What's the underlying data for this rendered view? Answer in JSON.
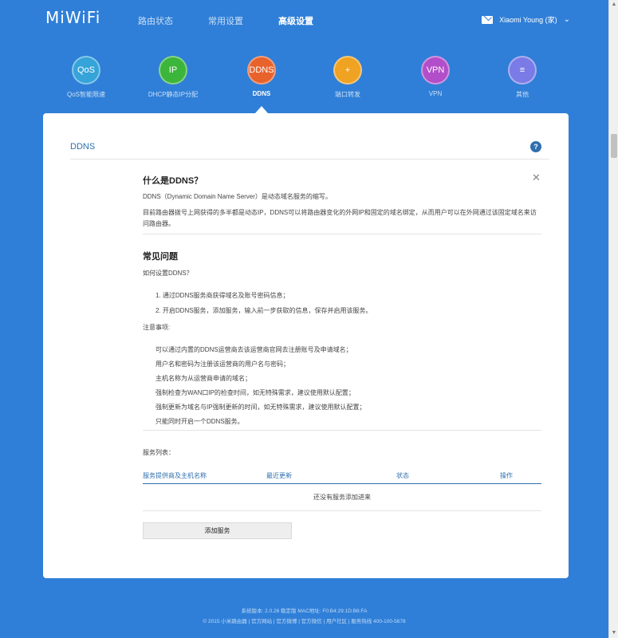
{
  "header": {
    "logo": "MiWiFi",
    "nav": [
      "路由状态",
      "常用设置",
      "高级设置"
    ],
    "user": "Xiaomi Young (家)"
  },
  "features": [
    {
      "icon_text": "QoS",
      "label": "QoS智能限速",
      "color": "#36a3d9"
    },
    {
      "icon_text": "IP",
      "label": "DHCP静态IP分配",
      "color": "#3bb53a"
    },
    {
      "icon_text": "DDNS",
      "label": "DDNS",
      "color": "#e8622c"
    },
    {
      "icon_text": "+",
      "label": "端口转发",
      "color": "#f0a223"
    },
    {
      "icon_text": "VPN",
      "label": "VPN",
      "color": "#b24ec9"
    },
    {
      "icon_text": "≡",
      "label": "其他",
      "color": "#7a7be6"
    }
  ],
  "card": {
    "title": "DDNS",
    "help_icon": "?",
    "what_title": "什么是DDNS？",
    "what_p1": "DDNS（Dynamic Domain Name Server）是动态域名服务的缩写。",
    "what_p2": "目前路由器拨号上网获得的多半都是动态IP，DDNS可以将路由器变化的外网IP和固定的域名绑定，从而用户可以在外网通过该固定域名来访问路由器。",
    "faq_title": "常见问题",
    "faq_q": "如何设置DDNS？",
    "faq_steps": [
      "1. 通过DDNS服务商获得域名及账号密码信息；",
      "2. 开启DDNS服务，添加服务，输入前一步获取的信息，保存并启用该服务。"
    ],
    "notes_title": "注意事项:",
    "notes": [
      "可以通过内置的DDNS运营商去该运营商官网去注册账号及申请域名；",
      "用户名和密码为注册该运营商的用户名与密码；",
      "主机名称为从运营商申请的域名；",
      "强制检查为WAN口IP的检查时间，如无特殊需求，建议使用默认配置；",
      "强制更新为域名与IP强制更新的时间，如无特殊需求，建议使用默认配置；",
      "只能同时开启一个DDNS服务。"
    ],
    "service_list_title": "服务列表：",
    "table_headers": [
      "服务提供商及主机名称",
      "最近更新",
      "状态",
      "操作"
    ],
    "empty_text": "还没有服务添加进来",
    "add_button": "添加服务"
  },
  "footer": {
    "line1": "系统版本: 2.0.26 稳定版    MAC地址: F0:B4:29:1D:B6:FA",
    "line2": "© 2015 小米路由器  |  官方网站  |  官方微博  |  官方微信  |  用户社区  |  服务热线 400-100-5678"
  }
}
